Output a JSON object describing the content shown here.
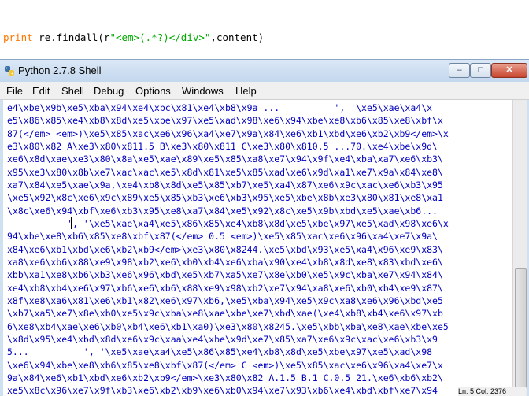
{
  "editor": {
    "code": {
      "keyword": "print",
      "middle": " re.findall(r",
      "string": "\"<em>(.*?)</div>\"",
      "end": ",content)"
    }
  },
  "window": {
    "title": "Python 2.7.8 Shell",
    "buttons": {
      "minimize": "–",
      "maximize": "□",
      "close": "✕"
    }
  },
  "menu": {
    "file": "File",
    "edit": "Edit",
    "shell": "Shell",
    "debug": "Debug",
    "options": "Options",
    "windows": "Windows",
    "help": "Help"
  },
  "output_lines": [
    "e4\\xbe\\x9b\\xe5\\xba\\x94\\xe4\\xbc\\x81\\xe4\\xb8\\x9a ...          ', '\\xe5\\xae\\xa4\\x",
    "e5\\x86\\x85\\xe4\\xb8\\x8d\\xe5\\xbe\\x97\\xe5\\xad\\x98\\xe6\\x94\\xbe\\xe8\\xb6\\x85\\xe8\\xbf\\x",
    "87(</em> <em>)\\xe5\\x85\\xac\\xe6\\x96\\xa4\\xe7\\x9a\\x84\\xe6\\xb1\\xbd\\xe6\\xb2\\xb9</em>\\x",
    "e3\\x80\\x82 A\\xe3\\x80\\x811.5 B\\xe3\\x80\\x811 C\\xe3\\x80\\x810.5 ...70.\\xe4\\xbe\\x9d\\",
    "xe6\\x8d\\xae\\xe3\\x80\\x8a\\xe5\\xae\\x89\\xe5\\x85\\xa8\\xe7\\x94\\x9f\\xe4\\xba\\xa7\\xe6\\xb3\\",
    "x95\\xe3\\x80\\x8b\\xe7\\xac\\xac\\xe5\\x8d\\x81\\xe5\\x85\\xad\\xe6\\x9d\\xa1\\xe7\\x9a\\x84\\xe8\\",
    "xa7\\x84\\xe5\\xae\\x9a,\\xe4\\xb8\\x8d\\xe5\\x85\\xb7\\xe5\\xa4\\x87\\xe6\\x9c\\xac\\xe6\\xb3\\x95",
    "\\xe5\\x92\\x8c\\xe6\\x9c\\x89\\xe5\\x85\\xb3\\xe6\\xb3\\x95\\xe5\\xbe\\x8b\\xe3\\x80\\x81\\xe8\\xa1",
    "\\x8c\\xe6\\x94\\xbf\\xe6\\xb3\\x95\\xe8\\xa7\\x84\\xe5\\x92\\x8c\\xe5\\x9b\\xbd\\xe5\\xae\\xb6...",
    "           ', '\\xe5\\xae\\xa4\\xe5\\x86\\x85\\xe4\\xb8\\x8d\\xe5\\xbe\\x97\\xe5\\xad\\x98\\xe6\\x",
    "94\\xbe\\xe8\\xb6\\x85\\xe8\\xbf\\x87(</em> 0.5 <em>)\\xe5\\x85\\xac\\xe6\\x96\\xa4\\xe7\\x9a\\",
    "x84\\xe6\\xb1\\xbd\\xe6\\xb2\\xb9</em>\\xe3\\x80\\x8244.\\xe5\\xbd\\x93\\xe5\\xa4\\x96\\xe9\\x83\\",
    "xa8\\xe6\\xb6\\x88\\xe9\\x98\\xb2\\xe6\\xb0\\xb4\\xe6\\xba\\x90\\xe4\\xb8\\x8d\\xe8\\x83\\xbd\\xe6\\",
    "xbb\\xa1\\xe8\\xb6\\xb3\\xe6\\x96\\xbd\\xe5\\xb7\\xa5\\xe7\\x8e\\xb0\\xe5\\x9c\\xba\\xe7\\x94\\x84\\",
    "xe4\\xb8\\xb4\\xe6\\x97\\xb6\\xe6\\xb6\\x88\\xe9\\x98\\xb2\\xe7\\x94\\xa8\\xe6\\xb0\\xb4\\xe9\\x87\\",
    "x8f\\xe8\\xa6\\x81\\xe6\\xb1\\x82\\xe6\\x97\\xb6,\\xe5\\xba\\x94\\xe5\\x9c\\xa8\\xe6\\x96\\xbd\\xe5",
    "\\xb7\\xa5\\xe7\\x8e\\xb0\\xe5\\x9c\\xba\\xe8\\xae\\xbe\\xe7\\xbd\\xae(\\xe4\\xb8\\xb4\\xe6\\x97\\xb",
    "6\\xe8\\xb4\\xae\\xe6\\xb0\\xb4\\xe6\\xb1\\xa0)\\xe3\\x80\\x8245.\\xe5\\xbb\\xba\\xe8\\xae\\xbe\\xe5",
    "\\x8d\\x95\\xe4\\xbd\\x8d\\xe6\\x9c\\xaa\\xe4\\xbe\\x9d\\xe7\\x85\\xa7\\xe6\\x9c\\xac\\xe6\\xb3\\x9",
    "5...          ', '\\xe5\\xae\\xa4\\xe5\\x86\\x85\\xe4\\xb8\\x8d\\xe5\\xbe\\x97\\xe5\\xad\\x98",
    "\\xe6\\x94\\xbe\\xe8\\xb6\\x85\\xe8\\xbf\\x87(</em> C <em>)\\xe5\\x85\\xac\\xe6\\x96\\xa4\\xe7\\x",
    "9a\\x84\\xe6\\xb1\\xbd\\xe6\\xb2\\xb9</em>\\xe3\\x80\\x82 A.1.5 B.1 C.0.5 21.\\xe6\\xb6\\xb2\\",
    "xe5\\x8c\\x96\\xe7\\x9f\\xb3\\xe6\\xb2\\xb9\\xe6\\xb0\\x94\\xe7\\x93\\xb6\\xe4\\xbd\\xbf\\xe7\\x94"
  ],
  "status_bar": "Ln: 5 Col: 2376"
}
